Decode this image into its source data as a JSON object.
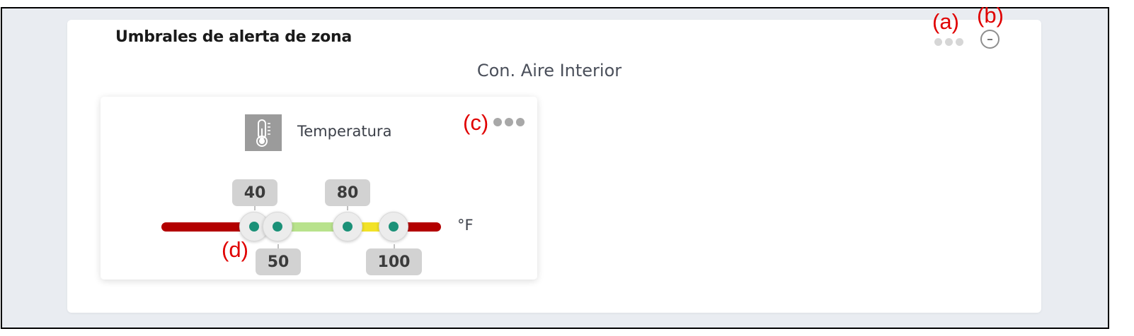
{
  "widget": {
    "title": "Umbrales de alerta de zona",
    "zone": "Con. Aire Interior"
  },
  "sensor": {
    "label": "Temperatura",
    "icon": "thermometer-icon",
    "unit": "°F",
    "thresholds": {
      "low_alarm": "40",
      "low_warning": "50",
      "high_warning": "80",
      "high_alarm": "100"
    },
    "colors": {
      "alarm": "#b30000",
      "warning": "#f2e227",
      "normal": "#b8e28c",
      "handle_dot": "#1b9178"
    }
  },
  "annotations": {
    "a": "(a)",
    "b": "(b)",
    "c": "(c)",
    "d": "(d)"
  }
}
